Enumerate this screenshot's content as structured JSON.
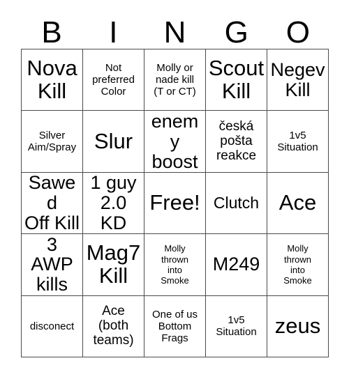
{
  "card": {
    "title": "Bingo Card",
    "header_letters": [
      "B",
      "I",
      "N",
      "G",
      "O"
    ],
    "columns": 5,
    "rows": 5,
    "colors": {
      "background": "#ffffff",
      "grid_line": "#4a4a4a",
      "text": "#000000"
    },
    "cells": [
      {
        "text": "Nova\nKill",
        "size": "fs-xxl"
      },
      {
        "text": "Not\npreferred\nColor",
        "size": "fs-sm"
      },
      {
        "text": "Molly or\nnade kill\n(T or CT)",
        "size": "fs-sm"
      },
      {
        "text": "Scout\nKill",
        "size": "fs-xxl"
      },
      {
        "text": "Negev\nKill",
        "size": "fs-xl"
      },
      {
        "text": "Silver\nAim/Spray",
        "size": "fs-sm"
      },
      {
        "text": "Slur",
        "size": "fs-xxl"
      },
      {
        "text": "enemy\nboost",
        "size": "fs-xl"
      },
      {
        "text": "česká\npošta\nreakce",
        "size": "fs-md"
      },
      {
        "text": "1v5\nSituation",
        "size": "fs-sm"
      },
      {
        "text": "Sawed\nOff Kill",
        "size": "fs-xl"
      },
      {
        "text": "1 guy\n2.0 KD",
        "size": "fs-xl"
      },
      {
        "text": "Free!",
        "size": "fs-xxl"
      },
      {
        "text": "Clutch",
        "size": "fs-lg"
      },
      {
        "text": "Ace",
        "size": "fs-xxl"
      },
      {
        "text": "3 AWP\nkills",
        "size": "fs-xl"
      },
      {
        "text": "Mag7\nKill",
        "size": "fs-xxl"
      },
      {
        "text": "Molly\nthrown\ninto\nSmoke",
        "size": "fs-xs"
      },
      {
        "text": "M249",
        "size": "fs-xl"
      },
      {
        "text": "Molly\nthrown\ninto\nSmoke",
        "size": "fs-xs"
      },
      {
        "text": "disconect",
        "size": "fs-sm"
      },
      {
        "text": "Ace\n(both\nteams)",
        "size": "fs-md"
      },
      {
        "text": "One of us\nBottom\nFrags",
        "size": "fs-sm"
      },
      {
        "text": "1v5\nSituation",
        "size": "fs-sm"
      },
      {
        "text": "zeus",
        "size": "fs-xxl"
      }
    ]
  }
}
